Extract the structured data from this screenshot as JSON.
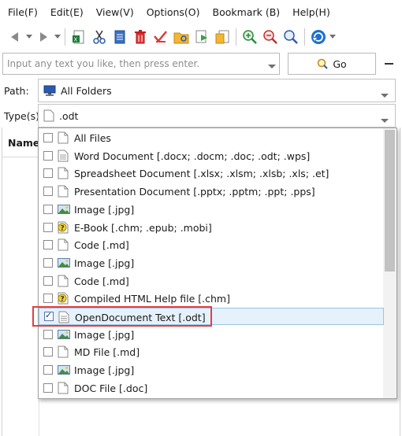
{
  "menu": [
    "File(F)",
    "Edit(E)",
    "View(V)",
    "Options(O)",
    "Bookmark (B)",
    "Help(H)"
  ],
  "search": {
    "placeholder": "Input any text you like, then press enter.",
    "go_label": "Go"
  },
  "path": {
    "label": "Path:",
    "value": "All Folders"
  },
  "types": {
    "label": "Type(s):",
    "value": ".odt"
  },
  "columns": {
    "name": "Name"
  },
  "type_list": [
    {
      "label": "All Files",
      "icon": "blank-doc-icon",
      "checked": false
    },
    {
      "label": "Word Document [.docx; .docm; .doc; .odt; .wps]",
      "icon": "text-doc-icon",
      "checked": false
    },
    {
      "label": "Spreadsheet Document [.xlsx; .xlsm; .xlsb; .xls; .et]",
      "icon": "blank-doc-icon",
      "checked": false
    },
    {
      "label": "Presentation Document [.pptx; .pptm; .ppt; .pps]",
      "icon": "blank-doc-icon",
      "checked": false
    },
    {
      "label": "Image [.jpg]",
      "icon": "image-icon",
      "checked": false
    },
    {
      "label": "E-Book [.chm; .epub; .mobi]",
      "icon": "help-doc-icon",
      "checked": false
    },
    {
      "label": "Code [.md]",
      "icon": "blank-doc-icon",
      "checked": false
    },
    {
      "label": "Image [.jpg]",
      "icon": "image-icon",
      "checked": false
    },
    {
      "label": "Code [.md]",
      "icon": "blank-doc-icon",
      "checked": false
    },
    {
      "label": "Compiled HTML Help file [.chm]",
      "icon": "help-doc-icon",
      "checked": false
    },
    {
      "label": "OpenDocument Text [.odt]",
      "icon": "text-doc-icon",
      "checked": true
    },
    {
      "label": "Image [.jpg]",
      "icon": "image-icon",
      "checked": false
    },
    {
      "label": "MD File [.md]",
      "icon": "blank-doc-icon",
      "checked": false
    },
    {
      "label": "Image [.jpg]",
      "icon": "image-icon",
      "checked": false
    },
    {
      "label": "DOC File [.doc]",
      "icon": "blank-doc-icon",
      "checked": false
    }
  ],
  "colors": {
    "highlight": "#e04040",
    "selection": "#e5f1fb",
    "accent": "#1e6fd0"
  }
}
